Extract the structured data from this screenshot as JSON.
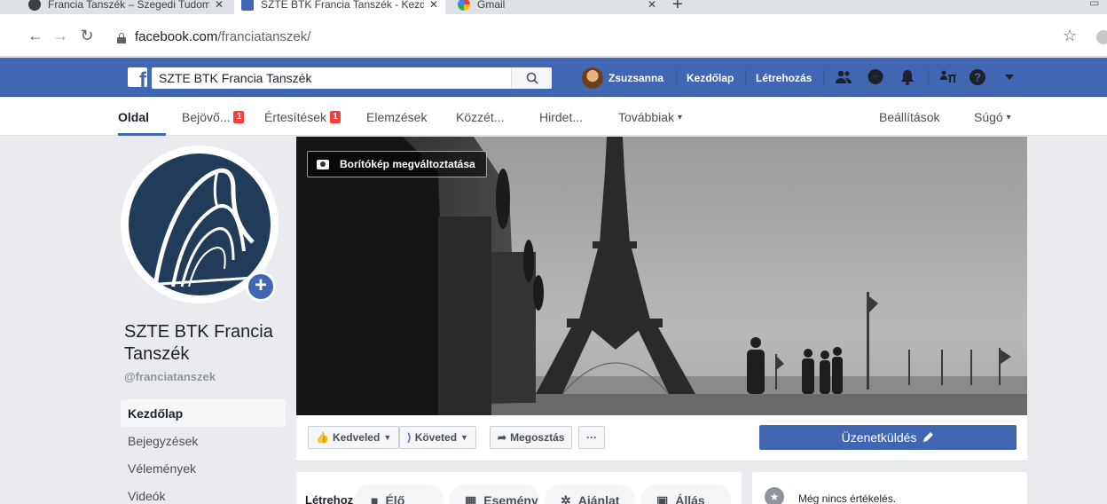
{
  "browser": {
    "tabs": [
      {
        "title": "Francia Tanszék – Szegedi Tudom",
        "close": "✕",
        "active": false
      },
      {
        "title": "SZTE BTK Francia Tanszék - Kezd",
        "close": "✕",
        "active": true
      },
      {
        "title": "Gmail",
        "close": "✕",
        "active": false
      }
    ],
    "new_tab": "+",
    "address": {
      "host": "facebook.com",
      "path": "/franciatanszek/"
    }
  },
  "topbar": {
    "search_value": "SZTE BTK Francia Tanszék",
    "user_name": "Zsuzsanna",
    "home_link": "Kezdőlap",
    "create_link": "Létrehozás",
    "brand_color": "#4267b2"
  },
  "page_nav": {
    "items": [
      {
        "label": "Oldal",
        "badge": ""
      },
      {
        "label": "Bejövő...",
        "badge": "1"
      },
      {
        "label": "Értesítések",
        "badge": "1"
      },
      {
        "label": "Elemzések",
        "badge": ""
      },
      {
        "label": "Közzét...",
        "badge": ""
      },
      {
        "label": "Hirdet...",
        "badge": ""
      },
      {
        "label": "Továbbiak",
        "badge": ""
      }
    ],
    "more_caret": "▾",
    "settings": "Beállítások",
    "help": "Súgó",
    "help_caret": "▾"
  },
  "profile": {
    "name": "SZTE BTK Francia Tanszék",
    "handle": "@franciatanszek"
  },
  "side_nav": [
    "Kezdőlap",
    "Bejegyzések",
    "Vélemények",
    "Videók"
  ],
  "cover": {
    "change_label": "Borítókép megváltoztatása"
  },
  "actions": {
    "like": "Kedveled",
    "follow": "Követed",
    "share": "Megosztás",
    "more": "···",
    "message": "Üzenetküldés"
  },
  "create": {
    "label": "Létrehoz",
    "pills": [
      "Élő",
      "Esemény",
      "Ajánlat",
      "Állás"
    ]
  },
  "reviews": {
    "text": "Még nincs értékelés."
  }
}
